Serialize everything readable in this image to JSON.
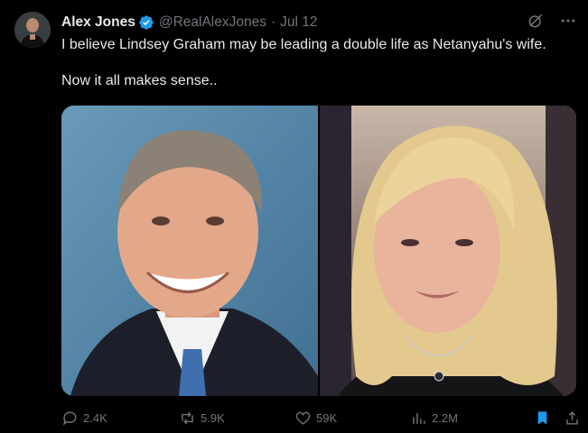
{
  "post": {
    "author_name": "Alex Jones",
    "author_handle": "@RealAlexJones",
    "separator": "·",
    "date": "Jul 12",
    "text": "I believe Lindsey Graham may be leading a double life as Netanyahu's wife.\n\nNow it all makes sense..",
    "verified": true
  },
  "actions": {
    "replies": "2.4K",
    "reposts": "5.9K",
    "likes": "59K",
    "views": "2.2M"
  },
  "icons": {
    "header": [
      "grok-icon",
      "more-icon"
    ],
    "footer": [
      "reply-icon",
      "repost-icon",
      "like-icon",
      "views-icon",
      "bookmark-icon",
      "share-icon"
    ]
  },
  "colors": {
    "background": "#000000",
    "text": "#e7e9ea",
    "secondary": "#71767b",
    "verified": "#1d9bf0",
    "bookmark": "#1d9bf0"
  }
}
